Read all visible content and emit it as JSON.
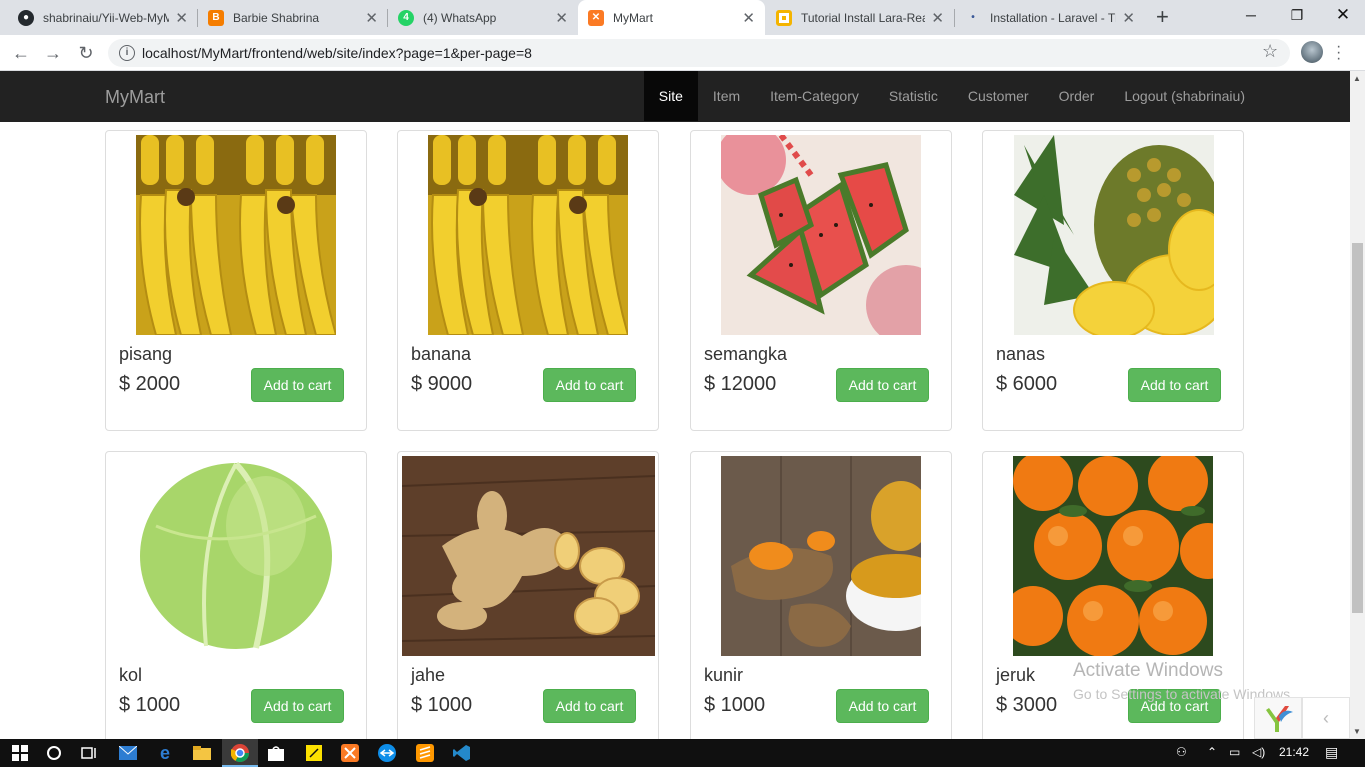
{
  "browser": {
    "tabs": [
      {
        "title": "shabrinaiu/Yii-Web-MyMart",
        "icon": "github-icon",
        "color": "#24292e"
      },
      {
        "title": "Barbie Shabrina",
        "icon": "blogger-icon",
        "color": "#f57d00"
      },
      {
        "title": "(4) WhatsApp",
        "icon": "whatsapp-icon",
        "color": "#25d366"
      },
      {
        "title": "MyMart",
        "icon": "xampp-icon",
        "color": "#fb7a24"
      },
      {
        "title": "Tutorial Install Lara-React",
        "icon": "slides-icon",
        "color": "#f4b400"
      },
      {
        "title": "Installation - Laravel - The PHP",
        "icon": "laravel-icon",
        "color": "#3b5998"
      }
    ],
    "url": "localhost/MyMart/frontend/web/site/index?page=1&per-page=8"
  },
  "navbar": {
    "brand": "MyMart",
    "links": [
      "Site",
      "Item",
      "Item-Category",
      "Statistic",
      "Customer",
      "Order",
      "Logout (shabrinaiu)"
    ],
    "active": "Site"
  },
  "products": [
    {
      "name": "pisang",
      "price": "$ 2000",
      "button": "Add to cart",
      "image": "banana"
    },
    {
      "name": "banana",
      "price": "$ 9000",
      "button": "Add to cart",
      "image": "banana"
    },
    {
      "name": "semangka",
      "price": "$ 12000",
      "button": "Add to cart",
      "image": "watermelon"
    },
    {
      "name": "nanas",
      "price": "$ 6000",
      "button": "Add to cart",
      "image": "pineapple"
    },
    {
      "name": "kol",
      "price": "$ 1000",
      "button": "Add to cart",
      "image": "cabbage"
    },
    {
      "name": "jahe",
      "price": "$ 1000",
      "button": "Add to cart",
      "image": "ginger"
    },
    {
      "name": "kunir",
      "price": "$ 1000",
      "button": "Add to cart",
      "image": "turmeric"
    },
    {
      "name": "jeruk",
      "price": "$ 3000",
      "button": "Add to cart",
      "image": "orange"
    }
  ],
  "watermark": {
    "line1": "Activate Windows",
    "line2": "Go to Settings to activate Windows."
  },
  "taskbar": {
    "time": "21:42"
  },
  "colors": {
    "button_green": "#5cb85c",
    "navbar_bg": "#222222"
  }
}
